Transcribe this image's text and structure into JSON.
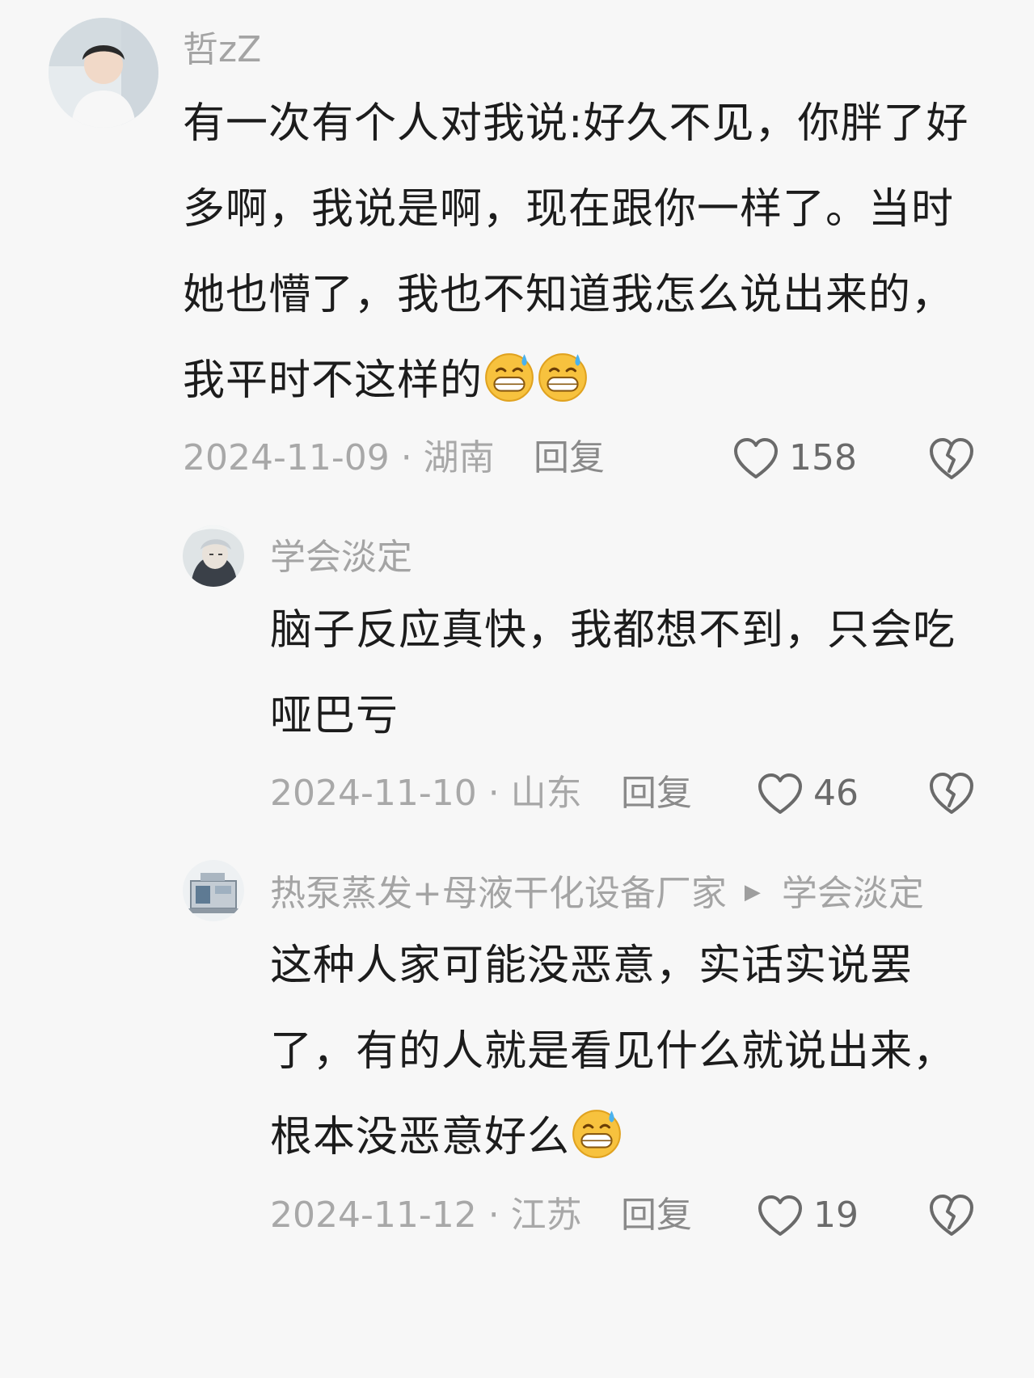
{
  "comments": [
    {
      "user": "哲zZ",
      "text": "有一次有个人对我说:好久不见，你胖了好多啊，我说是啊，现在跟你一样了。当时她也懵了，我也不知道我怎么说出来的，我平时不这样的",
      "emoji_count": 2,
      "date_location": "2024-11-09 · 湖南",
      "reply_label": "回复",
      "likes": "158"
    },
    {
      "user": "学会淡定",
      "text": "脑子反应真快，我都想不到，只会吃哑巴亏",
      "date_location": "2024-11-10 · 山东",
      "reply_label": "回复",
      "likes": "46"
    },
    {
      "user": "热泵蒸发+母液干化设备厂家",
      "reply_to": "学会淡定",
      "text": "这种人家可能没恶意，实话实说罢了，有的人就是看见什么就说出来，根本没恶意好么",
      "emoji_count": 1,
      "date_location": "2024-11-12 · 江苏",
      "reply_label": "回复",
      "likes": "19"
    }
  ],
  "icons": {
    "like": "heart-outline-icon",
    "dislike": "broken-heart-icon",
    "emoji": "grinning-sweat-emoji",
    "reply_arrow": "triangle-right-icon"
  },
  "colors": {
    "background": "#f7f7f7",
    "text": "#1c1c1c",
    "muted": "#a8a8a8"
  }
}
